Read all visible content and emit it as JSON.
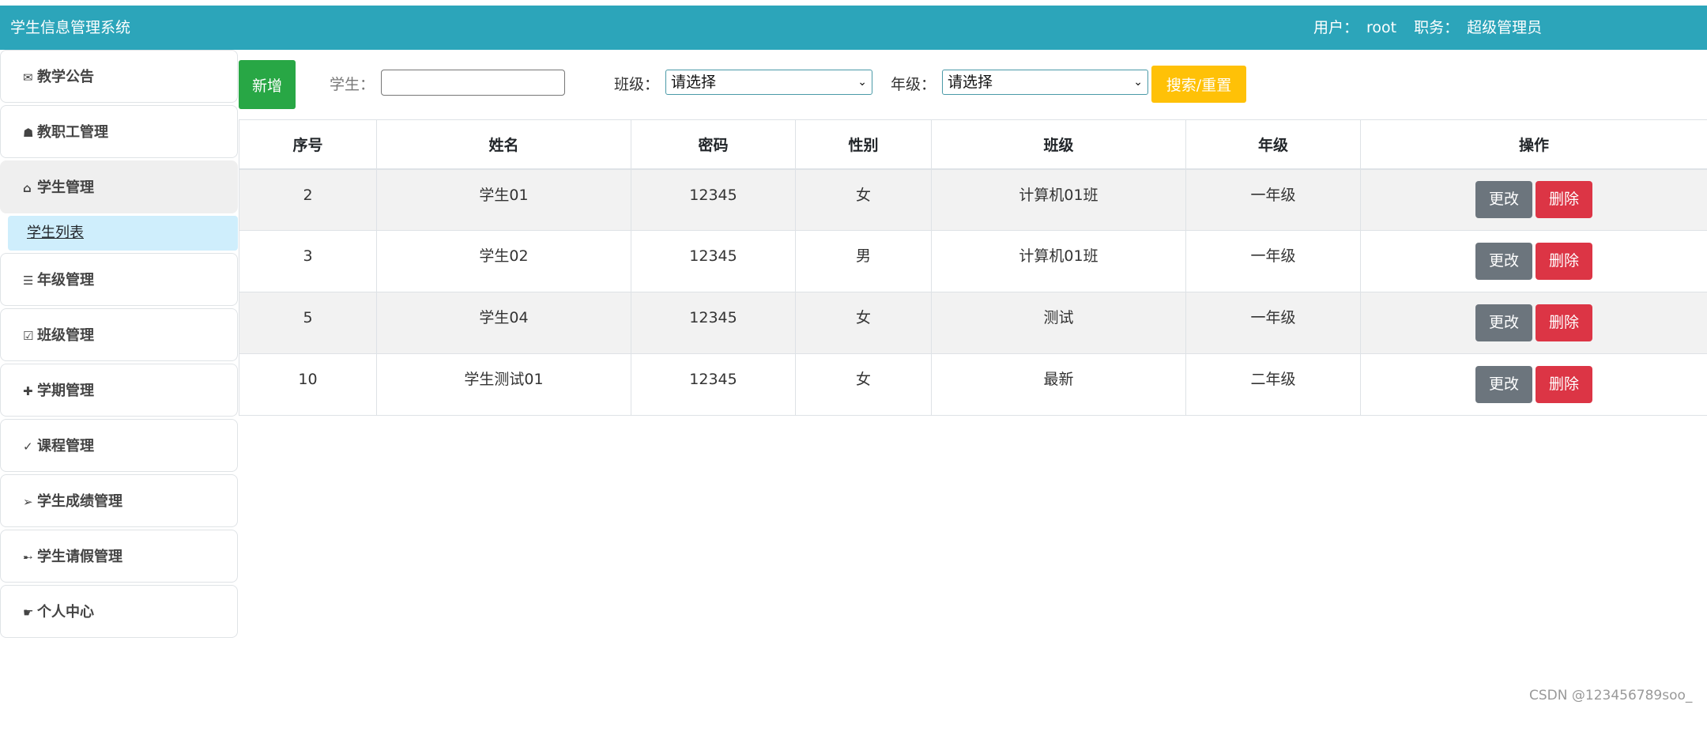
{
  "header": {
    "title": "学生信息管理系统",
    "user_label": "用户：",
    "user_name": "root",
    "role_label": "职务：",
    "role_name": "超级管理员"
  },
  "sidebar": {
    "items": [
      {
        "icon": "✉",
        "label": "教学公告"
      },
      {
        "icon": "☗",
        "label": "教职工管理"
      },
      {
        "icon": "⌂",
        "label": "学生管理"
      },
      {
        "icon": "☰",
        "label": "年级管理"
      },
      {
        "icon": "☑",
        "label": "班级管理"
      },
      {
        "icon": "✚",
        "label": "学期管理"
      },
      {
        "icon": "✓",
        "label": "课程管理"
      },
      {
        "icon": "➢",
        "label": "学生成绩管理"
      },
      {
        "icon": "➸",
        "label": "学生请假管理"
      },
      {
        "icon": "☛",
        "label": "个人中心"
      }
    ],
    "sub_items": [
      {
        "label": "学生列表"
      }
    ]
  },
  "toolbar": {
    "add_label": "新增",
    "student_label": "学生：",
    "student_value": "",
    "class_label": "班级：",
    "class_selected": "请选择",
    "grade_label": "年级：",
    "grade_selected": "请选择",
    "search_label": "搜索/重置"
  },
  "table": {
    "headers": [
      "序号",
      "姓名",
      "密码",
      "性别",
      "班级",
      "年级",
      "操作"
    ],
    "edit_label": "更改",
    "delete_label": "删除",
    "rows": [
      {
        "id": "2",
        "name": "学生01",
        "password": "12345",
        "gender": "女",
        "class": "计算机01班",
        "grade": "一年级"
      },
      {
        "id": "3",
        "name": "学生02",
        "password": "12345",
        "gender": "男",
        "class": "计算机01班",
        "grade": "一年级"
      },
      {
        "id": "5",
        "name": "学生04",
        "password": "12345",
        "gender": "女",
        "class": "测试",
        "grade": "一年级"
      },
      {
        "id": "10",
        "name": "学生测试01",
        "password": "12345",
        "gender": "女",
        "class": "最新",
        "grade": "二年级"
      }
    ]
  },
  "watermark": "CSDN @123456789soo_",
  "colors": {
    "header_bg": "#2ca5ba",
    "add_button": "#28a745",
    "search_button": "#ffc107",
    "edit_button": "#6c757d",
    "delete_button": "#dc3545",
    "active_sub_bg": "#cfeefc"
  }
}
